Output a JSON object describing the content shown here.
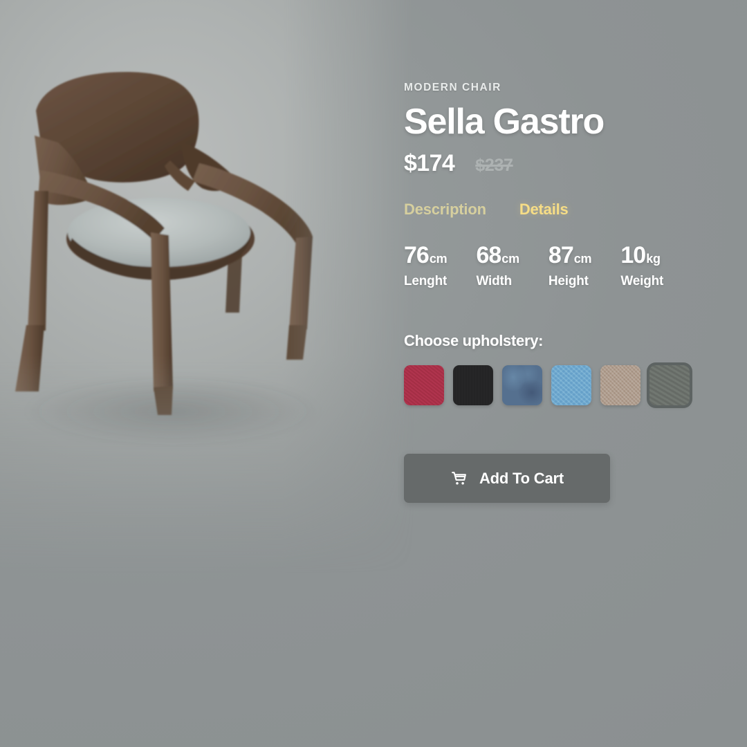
{
  "product": {
    "eyebrow": "MODERN CHAIR",
    "title": "Sella Gastro",
    "price_current": "$174",
    "price_original": "$237",
    "image_alt": "walnut-armchair-with-gray-upholstered-seat"
  },
  "tabs": [
    {
      "label": "Description",
      "active": false
    },
    {
      "label": "Details",
      "active": true
    }
  ],
  "specs": [
    {
      "value": "76",
      "unit": "cm",
      "label": "Lenght"
    },
    {
      "value": "68",
      "unit": "cm",
      "label": "Width"
    },
    {
      "value": "87",
      "unit": "cm",
      "label": "Height"
    },
    {
      "value": "10",
      "unit": "kg",
      "label": "Weight"
    }
  ],
  "upholstery": {
    "title": "Choose upholstery:",
    "options": [
      {
        "name": "crimson-red",
        "color": "#a93048",
        "selected": false
      },
      {
        "name": "black",
        "color": "#252526",
        "selected": false
      },
      {
        "name": "slate-blue",
        "color": "#55708f",
        "selected": false
      },
      {
        "name": "light-blue",
        "color": "#6fa8ce",
        "selected": false
      },
      {
        "name": "beige-taupe",
        "color": "#ad9b8c",
        "selected": false
      },
      {
        "name": "gray-green",
        "color": "#6b716b",
        "selected": true
      }
    ]
  },
  "cart": {
    "label": "Add To Cart",
    "icon": "shopping-cart-icon"
  },
  "theme": {
    "background": "#919697",
    "accent": "#f6dd86",
    "accent_muted": "#d6cf9e",
    "button": "#666a6a",
    "text": "#ffffff",
    "text_muted": "#adb2b2"
  }
}
